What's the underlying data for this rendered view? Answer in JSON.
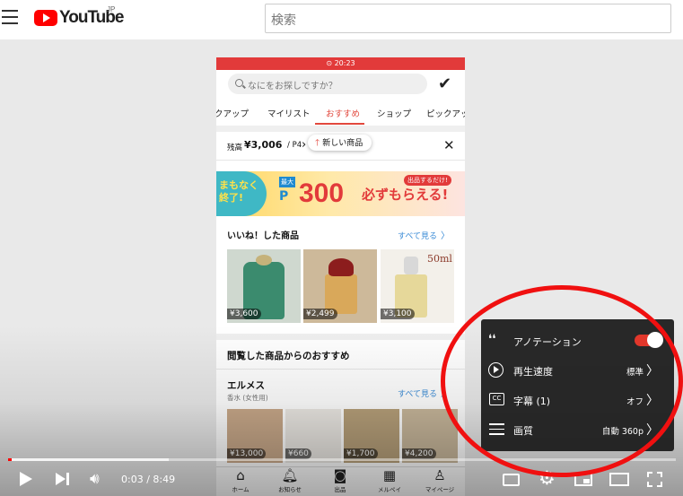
{
  "header": {
    "logo_text": "YouTube",
    "region": "JP",
    "search_placeholder": "検索"
  },
  "app": {
    "status_strip": "⊙ 20:23",
    "search_placeholder": "なにをお探しですか？",
    "tabs": [
      "クアップ",
      "マイリスト",
      "おすすめ",
      "ショップ",
      "ピックアッ"
    ],
    "active_tab": "おすすめ",
    "balance": {
      "label": "残高",
      "value": "¥3,006",
      "points": "/ P4",
      "chevron": "›"
    },
    "new_items": "新しい商品",
    "banner": {
      "ending_soon_line1": "まもなく",
      "ending_soon_line2": "終了!",
      "max": "最大",
      "points_prefix": "P",
      "points": "300",
      "get": "必ずもらえる!",
      "tag": "出品するだけ!"
    },
    "liked": {
      "title": "いいね！した商品",
      "see_all": "すべて見る",
      "items": [
        {
          "price": "¥3,600"
        },
        {
          "price": "¥2,499"
        },
        {
          "price": "¥3,100",
          "label": "50ml"
        }
      ]
    },
    "recommended_title": "閲覧した商品からのおすすめ",
    "brand": {
      "name": "エルメス",
      "category": "香水 (女性用)",
      "see_all": "すべて見る",
      "items": [
        {
          "price": "¥13,000"
        },
        {
          "price": "¥660"
        },
        {
          "price": "¥1,700"
        },
        {
          "price": "¥4,200"
        }
      ]
    },
    "bottom_nav": [
      "ホーム",
      "お知らせ",
      "出品",
      "メルペイ",
      "マイページ"
    ]
  },
  "player": {
    "time": "0:03 / 8:49",
    "progress": {
      "played_fraction": 0.006,
      "buffered_fraction": 0.24
    }
  },
  "settings_menu": {
    "items": [
      {
        "label": "アノテーション",
        "value": "",
        "toggle_on": true
      },
      {
        "label": "再生速度",
        "value": "標準"
      },
      {
        "label": "字幕 (1)",
        "value": "オフ"
      },
      {
        "label": "画質",
        "value": "自動 360p"
      }
    ]
  },
  "colors": {
    "youtube_red": "#ff0000",
    "app_red": "#e2483d",
    "link_blue": "#3a8bd6",
    "highlight_ring": "#f01010"
  }
}
